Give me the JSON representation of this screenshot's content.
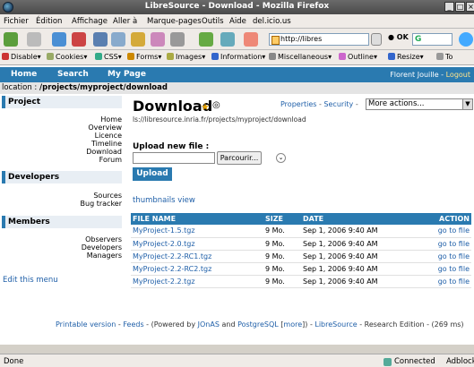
{
  "window": {
    "title": "LibreSource - Download - Mozilla Firefox",
    "buttons": [
      "_",
      "□",
      "×"
    ]
  },
  "menubar": [
    "Fichier",
    "Édition",
    "Affichage",
    "Aller à",
    "Marque-pages",
    "Outils",
    "Aide",
    "del.icio.us"
  ],
  "navbar": {
    "url": "http://libres",
    "ok_label": "OK",
    "search_value": "G"
  },
  "devbar": [
    {
      "label": "Disable▾",
      "color": "#c33"
    },
    {
      "label": "Cookies▾",
      "color": "#9a6"
    },
    {
      "label": "CSS▾",
      "color": "#3a8"
    },
    {
      "label": "Forms▾",
      "color": "#c80"
    },
    {
      "label": "Images▾",
      "color": "#aa4"
    },
    {
      "label": "Information▾",
      "color": "#36c"
    },
    {
      "label": "Miscellaneous▾",
      "color": "#888"
    },
    {
      "label": "Outline▾",
      "color": "#c6c"
    },
    {
      "label": "Resize▾",
      "color": "#36c"
    },
    {
      "label": "To",
      "color": "#999"
    }
  ],
  "topnav": {
    "home": "Home",
    "search": "Search",
    "mypage": "My Page",
    "user": "Florent Jouille",
    "logout": "Logout"
  },
  "location": {
    "prefix": "location : ",
    "path": "/projects/myproject/download"
  },
  "sidebar": {
    "project": {
      "title": "Project",
      "links": [
        "Home",
        "Overview",
        "Licence",
        "Timeline",
        "Download",
        "Forum"
      ]
    },
    "developers": {
      "title": "Developers",
      "links": [
        "Sources",
        "Bug tracker"
      ]
    },
    "members": {
      "title": "Members",
      "links": [
        "Observers",
        "Developers",
        "Managers"
      ]
    },
    "edit_menu": "Edit this menu"
  },
  "main": {
    "title": "Download",
    "url_path": "ls://libresource.inria.fr/projects/myproject/download",
    "links": {
      "properties": "Properties",
      "sep1": " - ",
      "security": "Security",
      "sep2": " - "
    },
    "more_actions": "More actions...",
    "upload_label": "Upload new file :",
    "browse_label": "Parcourir...",
    "upload_button": "Upload",
    "thumbnails": "thumbnails view"
  },
  "table": {
    "headers": {
      "name": "FILE NAME",
      "size": "SIZE",
      "date": "DATE",
      "action": "ACTION"
    },
    "rows": [
      {
        "name": "MyProject-1.5.tgz",
        "size": "9 Mo.",
        "date": "Sep 1, 2006 9:40 AM",
        "action": "go to file"
      },
      {
        "name": "MyProject-2.0.tgz",
        "size": "9 Mo.",
        "date": "Sep 1, 2006 9:40 AM",
        "action": "go to file"
      },
      {
        "name": "MyProject-2.2-RC1.tgz",
        "size": "9 Mo.",
        "date": "Sep 1, 2006 9:40 AM",
        "action": "go to file"
      },
      {
        "name": "MyProject-2.2-RC2.tgz",
        "size": "9 Mo.",
        "date": "Sep 1, 2006 9:40 AM",
        "action": "go to file"
      },
      {
        "name": "MyProject-2.2.tgz",
        "size": "9 Mo.",
        "date": "Sep 1, 2006 9:40 AM",
        "action": "go to file"
      }
    ]
  },
  "footer": {
    "printable": "Printable version",
    "t1": " - ",
    "feeds": "Feeds",
    "t2": " - (Powered by ",
    "jonas": "JOnAS",
    "t3": " and ",
    "postgres": "PostgreSQL",
    "t4": " [",
    "more": "more",
    "t5": "]) - ",
    "libresource": "LibreSource",
    "t6": " - Research Edition - (269 ms)"
  },
  "statusbar": {
    "done": "Done",
    "connected": "Connected",
    "adblock": "Adblock"
  }
}
